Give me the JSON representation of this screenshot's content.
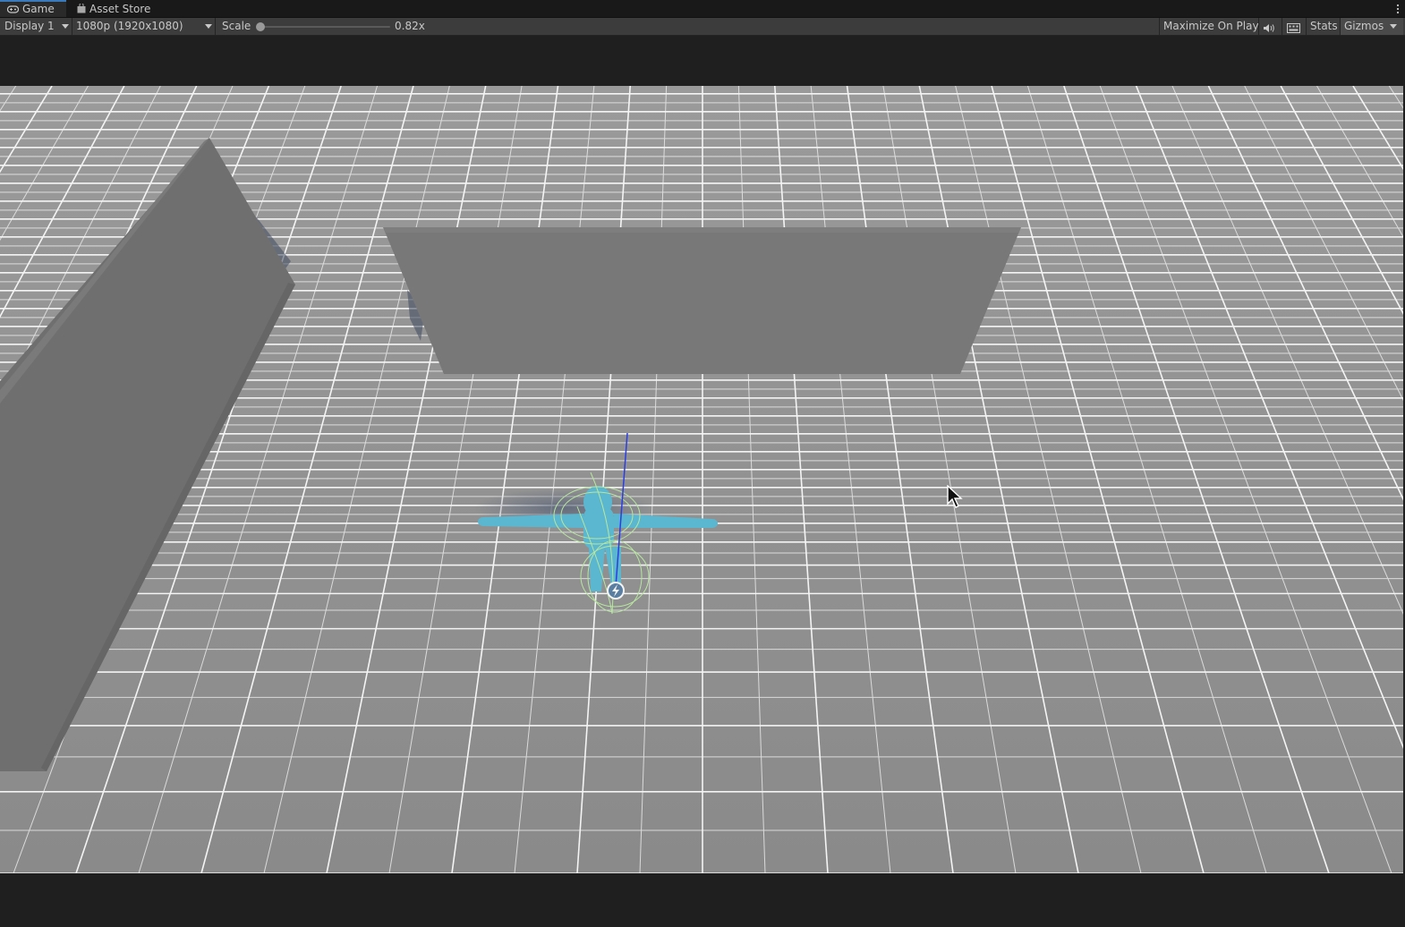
{
  "tabs": {
    "game_label": "Game",
    "asset_store_label": "Asset Store"
  },
  "toolbar": {
    "display_label": "Display 1",
    "resolution_label": "1080p (1920x1080)",
    "scale_label": "Scale",
    "scale_value": "0.82x",
    "maximize_label": "Maximize On Play",
    "stats_label": "Stats",
    "gizmos_label": "Gizmos"
  },
  "icons": {
    "game_tab": "gamepad-icon",
    "asset_store_tab": "shopping-bag-icon",
    "mute": "speaker-icon",
    "keyboard": "keyboard-icon",
    "menu": "kebab-menu-icon",
    "cursor": "mouse-pointer-icon"
  },
  "colors": {
    "editor_bg": "#1e1e1e",
    "toolbar_bg": "#3c3c3c",
    "floor": "#8c8c8c",
    "grid_line": "#e6e6e6",
    "wall": "#787878",
    "character": "#5bb7cf",
    "collider_gizmo": "#b8e6a0",
    "axis_gizmo": "#2b3fe0"
  }
}
